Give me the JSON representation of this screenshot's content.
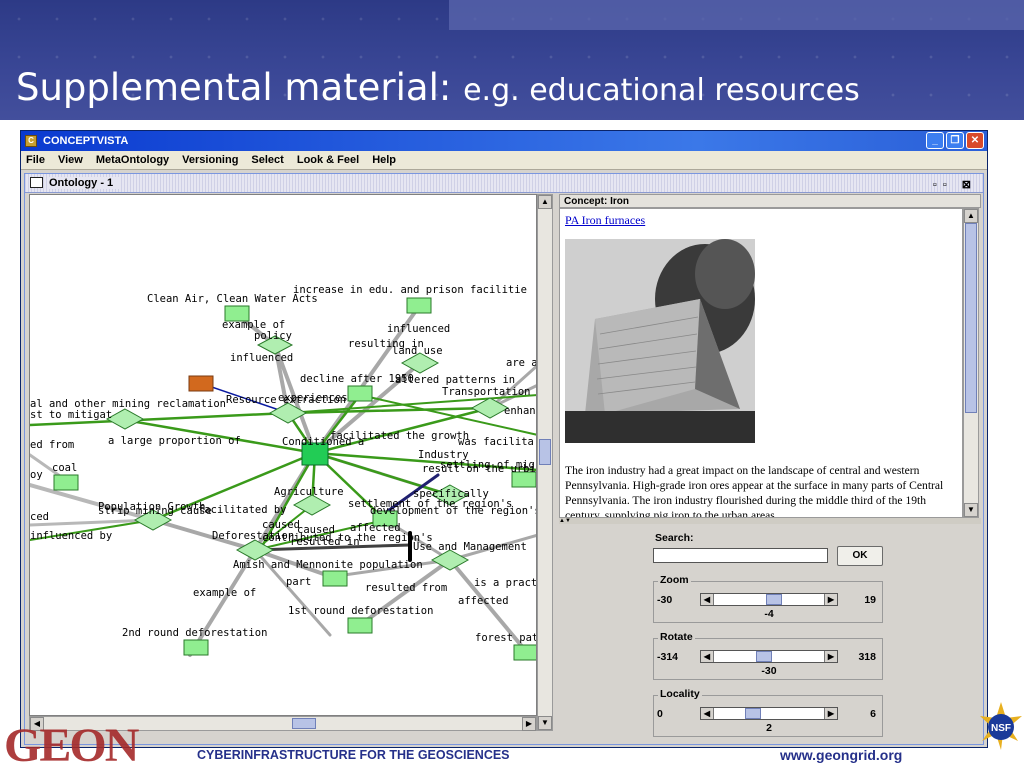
{
  "slide": {
    "title_main": "Supplemental material:",
    "title_sub": "e.g. educational resources",
    "footer_text": "CYBERINFRASTRUCTURE FOR THE GEOSCIENCES",
    "footer_url": "www.geongrid.org",
    "logo_text": "GEON",
    "nsf_text": "NSF"
  },
  "window": {
    "title": "CONCEPTVISTA",
    "menu": [
      "File",
      "View",
      "MetaOntology",
      "Versioning",
      "Select",
      "Look & Feel",
      "Help"
    ],
    "inner_title": "Ontology - 1"
  },
  "graph": {
    "labels": [
      "increase in edu. and prison facilitie",
      "Clean Air, Clean Water Acts",
      "example of",
      "policy",
      "influenced",
      "resulting in",
      "land use",
      "influenced",
      "are a",
      "decline after 1950",
      "altered patterns in",
      "Transportation",
      "al and other mining reclamation",
      "Resource extraction",
      "experiences",
      "enhan",
      "st to mitigat",
      "facilitated the growth",
      "ed from",
      "a large proportion of",
      "Conditioned a",
      "was facilita",
      "Industry",
      "coal",
      "settling of mig",
      "result on the urbi",
      "oy",
      "Agriculture",
      "specifically",
      "Population Growth",
      "strip mining cause",
      "facilitated by",
      "settlement of the region's",
      "development of the region's",
      "ced",
      "caused",
      "caused",
      "affected",
      "influenced by",
      "Deforestation",
      "resulted in",
      "contributed to the region's",
      "Use and Management",
      "Amish and Mennonite population",
      "part",
      "resulted from",
      "is a practi",
      "example of",
      "affected",
      "1st round deforestation",
      "2nd round deforestation",
      "forest pat"
    ]
  },
  "concept": {
    "title": "Concept: Iron",
    "link": "PA Iron furnaces",
    "text": "The iron industry had a great impact on the landscape of central and western Pennsylvania. High-grade iron ores appear at the surface in many parts of Central Pennsylvania. The iron industry flourished during the middle third of the 19th century, supplying pig iron to the urban areas"
  },
  "controls": {
    "search_label": "Search:",
    "search_value": "",
    "ok_label": "OK",
    "zoom": {
      "label": "Zoom",
      "min": "-30",
      "max": "19",
      "value": "-4",
      "fraction": 0.55
    },
    "rotate": {
      "label": "Rotate",
      "min": "-314",
      "max": "318",
      "value": "-30",
      "fraction": 0.45
    },
    "locality": {
      "label": "Locality",
      "min": "0",
      "max": "6",
      "value": "2",
      "fraction": 0.33
    }
  },
  "colors": {
    "node_fill": "#90ee90",
    "node_center": "#22cc55",
    "node_orange": "#d2691e",
    "edge_green": "#3a9a1a",
    "edge_gray": "#a0a0a0",
    "edge_blue": "#0a1aa0"
  }
}
